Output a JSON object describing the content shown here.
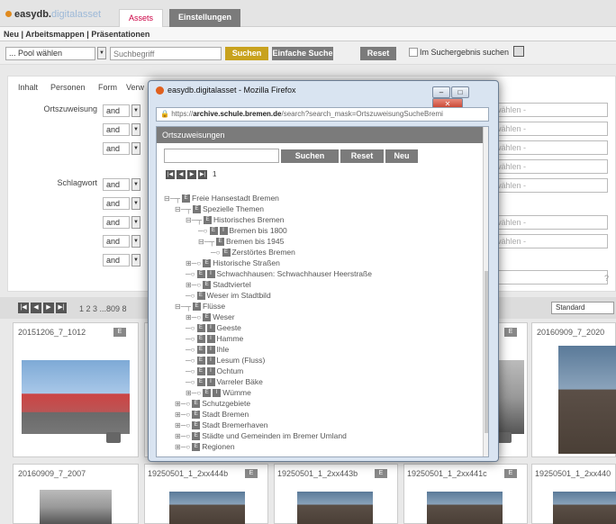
{
  "app": {
    "logo_main": "easydb.",
    "logo_light": "digitalasset"
  },
  "tabs": {
    "assets": "Assets",
    "einstellungen": "Einstellungen"
  },
  "menu": {
    "neu": "Neu",
    "arbeitsmappen": "Arbeitsmappen",
    "praesentationen": "Präsentationen",
    "sep": "|"
  },
  "searchbar": {
    "pool": "... Pool wählen",
    "search_placeholder": "Suchbegriff",
    "suchen": "Suchen",
    "einfache_suche": "Einfache Suche",
    "reset": "Reset",
    "im_suchergebnis": "Im Suchergebnis suchen"
  },
  "form": {
    "tabs": [
      "Inhalt",
      "Personen",
      "Form",
      "Verw"
    ],
    "ortszuweisung": "Ortszuweisung",
    "schlagwort": "Schlagwort",
    "and": "and",
    "waehlen": "wählen -",
    "question": "?"
  },
  "pager": {
    "pages": "1  2  3  ...809  8",
    "sort": "Standard",
    "first": "|◀",
    "prev": "◀",
    "next": "▶",
    "last": "▶|"
  },
  "cards": {
    "row1": [
      "20151206_7_1012",
      "20160909_7_2020"
    ],
    "row2": [
      "20160909_7_2007",
      "19250501_1_2xx444b",
      "19250501_1_2xx443b",
      "19250501_1_2xx441c",
      "19250501_1_2xx440"
    ],
    "badge": "E"
  },
  "popup": {
    "window_title": "easydb.digitalasset - Mozilla Firefox",
    "url_prefix": "https://",
    "url_domain": "archive.schule.bremen.de",
    "url_rest": "/search?search_mask=OrtszuweisungSucheBremi",
    "header": "Ortszuweisungen",
    "suchen": "Suchen",
    "reset": "Reset",
    "neu": "Neu",
    "page": "1",
    "tree": [
      "Freie Hansestadt Bremen",
      "Spezielle Themen",
      "Historisches Bremen",
      "Bremen bis 1800",
      "Bremen bis 1945",
      "Zerstörtes Bremen",
      "Historische Straßen",
      "Schwachhausen: Schwachhauser Heerstraße",
      "Stadtviertel",
      "Weser im Stadtbild",
      "Flüsse",
      "Weser",
      "Geeste",
      "Hamme",
      "Ihle",
      "Lesum (Fluss)",
      "Ochtum",
      "Varreler Bäke",
      "Wümme",
      "Schutzgebiete",
      "Stadt Bremen",
      "Stadt Bremerhaven",
      "Städte und Gemeinden im Bremer Umland",
      "Regionen"
    ]
  },
  "colors": {
    "accent_gold": "#c8a21e",
    "dark_gray": "#7b7b7b",
    "firefox_orange": "#e0601e"
  }
}
